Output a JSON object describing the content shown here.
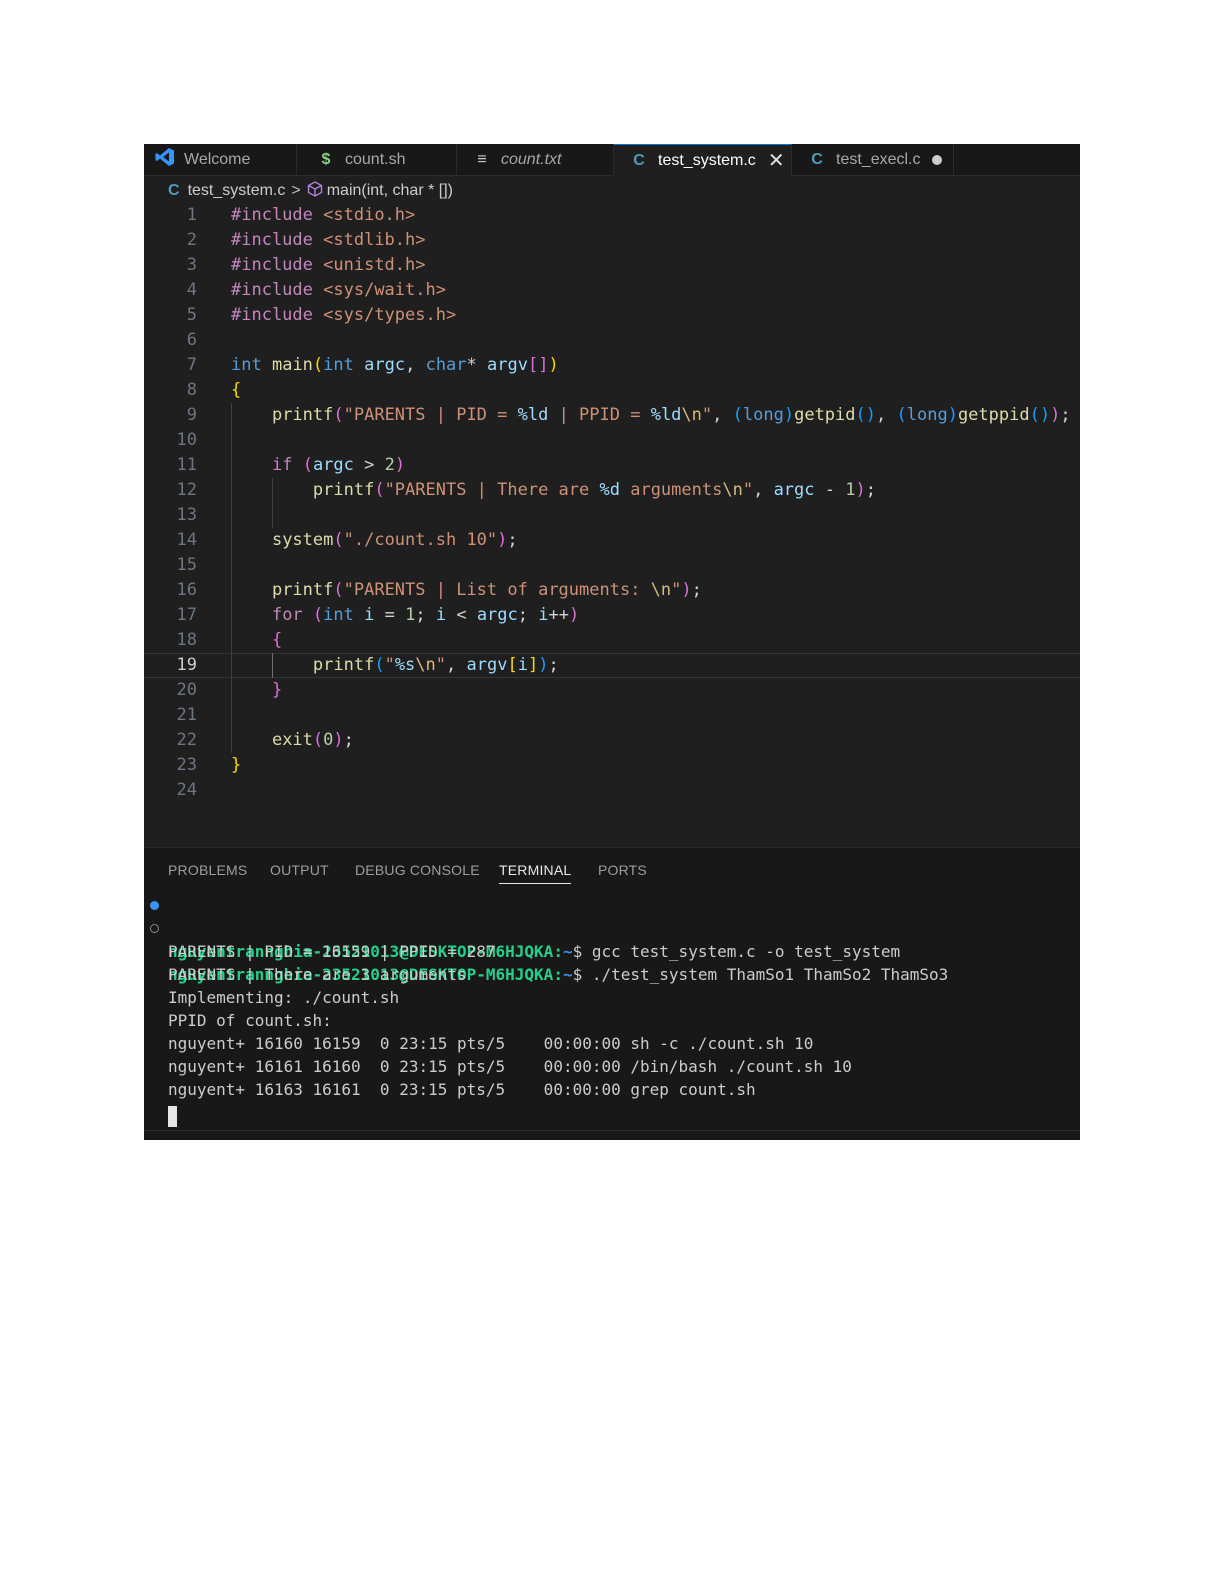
{
  "tabs": [
    {
      "label": "Welcome",
      "icon": "vscode-logo-icon",
      "icon_color": "#3794ff"
    },
    {
      "label": "count.sh",
      "icon": "dollar-icon",
      "icon_glyph": "$",
      "icon_color": "#89d185"
    },
    {
      "label": "count.txt",
      "icon": "text-lines-icon",
      "icon_glyph": "≡",
      "icon_color": "#cccccc",
      "italic": true
    },
    {
      "label": "test_system.c",
      "icon": "c-file-icon",
      "icon_glyph": "C",
      "icon_color": "#519aba",
      "active": true,
      "close_glyph": "✕"
    },
    {
      "label": "test_execl.c",
      "icon": "c-file-icon",
      "icon_glyph": "C",
      "icon_color": "#519aba",
      "modified": true
    }
  ],
  "breadcrumb": {
    "file_icon": "C",
    "file": "test_system.c",
    "separator": ">",
    "symbol": "main(int, char * [])"
  },
  "editor": {
    "current_line": 19,
    "lines": [
      "1",
      "2",
      "3",
      "4",
      "5",
      "6",
      "7",
      "8",
      "9",
      "10",
      "11",
      "12",
      "13",
      "14",
      "15",
      "16",
      "17",
      "18",
      "19",
      "20",
      "21",
      "22",
      "23",
      "24"
    ]
  },
  "panel": {
    "tabs": [
      "PROBLEMS",
      "OUTPUT",
      "DEBUG CONSOLE",
      "TERMINAL",
      "PORTS"
    ],
    "active_tab": "TERMINAL"
  },
  "terminal": {
    "prompt_user": "nguyentrannghia-23521013@DESKTOP-M6HJQKA",
    "prompt_sep": ":",
    "prompt_path": "~",
    "prompt_end": "$ ",
    "commands": [
      "gcc test_system.c -o test_system",
      "./test_system ThamSo1 ThamSo2 ThamSo3"
    ],
    "output": [
      "PARENTS | PID = 16159 | PPID = 287",
      "PARENTS | There are 3 arguments",
      "Implementing: ./count.sh",
      "PPID of count.sh:",
      "nguyent+ 16160 16159  0 23:15 pts/5    00:00:00 sh -c ./count.sh 10",
      "nguyent+ 16161 16160  0 23:15 pts/5    00:00:00 /bin/bash ./count.sh 10",
      "nguyent+ 16163 16161  0 23:15 pts/5    00:00:00 grep count.sh"
    ]
  },
  "colors": {
    "editor_bg": "#1f1f1f",
    "panel_bg": "#181818",
    "accent": "#0078d4"
  }
}
